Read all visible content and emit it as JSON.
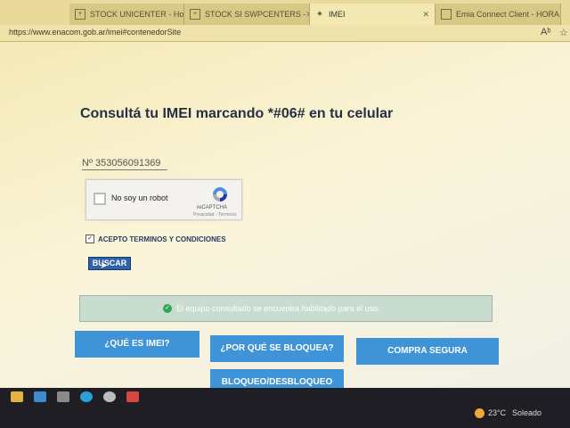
{
  "tabs": [
    {
      "label": "STOCK UNICENTER - Hojas d",
      "icon": "sheets-icon"
    },
    {
      "label": "STOCK SI SWPCENTERS - ",
      "icon": "sheets-icon"
    },
    {
      "label": "IMEI",
      "icon": "enacom-icon",
      "active": true
    },
    {
      "label": "Emia Connect Client - HORA",
      "icon": "page-icon"
    }
  ],
  "address": {
    "url": "https://www.enacom.gob.ar/imei#contenedorSite"
  },
  "page": {
    "title": "Consultá tu IMEI marcando *#06# en tu celular",
    "imei_value": "Nº 353056091369",
    "captcha": {
      "label": "No soy un robot",
      "brand": "reCAPTCHA",
      "privacy": "Privacidad - Términos"
    },
    "terms_label": "ACEPTO TERMINOS Y CONDICIONES",
    "search_button": "BUSCAR",
    "status_message": "El equipo consultado se encuentra habilitado para el uso.",
    "buttons": {
      "que_es": "¿QUÉ ES IMEI?",
      "por_que": "¿POR QUÉ SE BLOQUEA?",
      "compra": "COMPRA SEGURA",
      "bloqueo": "BLOQUEO/DESBLOQUEO"
    }
  },
  "taskbar": {
    "temperature": "23°C",
    "condition": "Soleado"
  },
  "colors": {
    "accent": "#3f94d8",
    "success": "#2ea84e",
    "title": "#262f46"
  }
}
